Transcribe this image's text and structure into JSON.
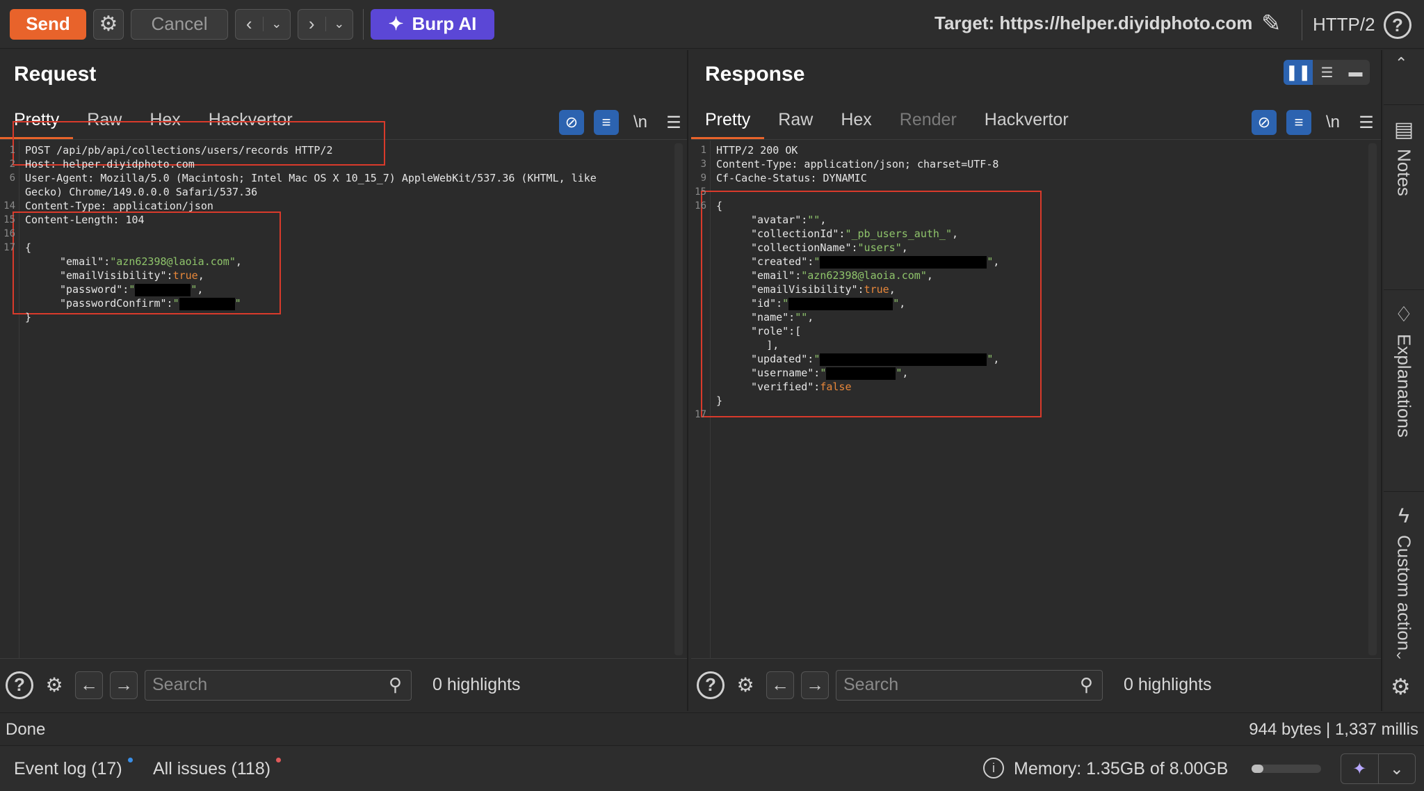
{
  "toolbar": {
    "send_label": "Send",
    "cancel_label": "Cancel",
    "burp_ai_label": "Burp AI",
    "target_label": "Target: https://helper.diyidphoto.com",
    "protocol_label": "HTTP/2"
  },
  "request": {
    "title": "Request",
    "tabs": [
      "Pretty",
      "Raw",
      "Hex",
      "Hackvertor"
    ],
    "active_tab": "Pretty",
    "wrap_label": "\\n",
    "lines": [
      {
        "n": "1",
        "text": "POST /api/pb/api/collections/users/records HTTP/2"
      },
      {
        "n": "2",
        "text": "Host: helper.diyidphoto.com"
      },
      {
        "n": "6",
        "text": "User-Agent: Mozilla/5.0 (Macintosh; Intel Mac OS X 10_15_7) AppleWebKit/537.36 (KHTML, like"
      },
      {
        "n": "",
        "text": "Gecko) Chrome/149.0.0.0 Safari/537.36"
      },
      {
        "n": "14",
        "text": "Content-Type: application/json"
      },
      {
        "n": "15",
        "text": "Content-Length: 104"
      },
      {
        "n": "16",
        "text": ""
      },
      {
        "n": "17",
        "text": "{"
      },
      {
        "n": "",
        "key": "\"email\":",
        "str": "\"azn62398@laoia.com\"",
        "tail": ","
      },
      {
        "n": "",
        "key": "\"emailVisibility\":",
        "bool": "true",
        "tail": ","
      },
      {
        "n": "",
        "key": "\"password\":",
        "str": "\"",
        "redact": "w80",
        "str2": "\"",
        "tail": ","
      },
      {
        "n": "",
        "key": "\"passwordConfirm\":",
        "str": "\"",
        "redact": "w80",
        "str2": "\""
      },
      {
        "n": "",
        "text": "}"
      }
    ]
  },
  "response": {
    "title": "Response",
    "tabs": [
      "Pretty",
      "Raw",
      "Hex",
      "Render",
      "Hackvertor"
    ],
    "active_tab": "Pretty",
    "wrap_label": "\\n",
    "lines": [
      {
        "n": "1",
        "text": "HTTP/2 200 OK"
      },
      {
        "n": "3",
        "text": "Content-Type: application/json; charset=UTF-8"
      },
      {
        "n": "9",
        "text": "Cf-Cache-Status: DYNAMIC"
      },
      {
        "n": "15",
        "text": ""
      },
      {
        "n": "16",
        "text": "{"
      },
      {
        "n": "",
        "key": "\"avatar\":",
        "str": "\"\"",
        "tail": ","
      },
      {
        "n": "",
        "key": "\"collectionId\":",
        "str": "\"_pb_users_auth_\"",
        "tail": ","
      },
      {
        "n": "",
        "key": "\"collectionName\":",
        "str": "\"users\"",
        "tail": ","
      },
      {
        "n": "",
        "key": "\"created\":",
        "str": "\"",
        "redact": "w240",
        "str2": "\"",
        "tail": ","
      },
      {
        "n": "",
        "key": "\"email\":",
        "str": "\"azn62398@laoia.com\"",
        "tail": ","
      },
      {
        "n": "",
        "key": "\"emailVisibility\":",
        "bool": "true",
        "tail": ","
      },
      {
        "n": "",
        "key": "\"id\":",
        "str": "\"",
        "redact": "w150",
        "str2": "\"",
        "tail": ","
      },
      {
        "n": "",
        "key": "\"name\":",
        "str": "\"\"",
        "tail": ","
      },
      {
        "n": "",
        "key": "\"role\":",
        "text2": "["
      },
      {
        "n": "",
        "text": "        ],"
      },
      {
        "n": "",
        "key": "\"updated\":",
        "str": "\"",
        "redact": "w240",
        "str2": "\"",
        "tail": ","
      },
      {
        "n": "",
        "key": "\"username\":",
        "str": "\"",
        "redact": "w100",
        "str2": "\"",
        "tail": ","
      },
      {
        "n": "",
        "key": "\"verified\":",
        "bool": "false"
      },
      {
        "n": "",
        "text": "}"
      },
      {
        "n": "17",
        "text": ""
      }
    ]
  },
  "search": {
    "placeholder": "Search",
    "left_highlights": "0 highlights",
    "right_highlights": "0 highlights"
  },
  "sidebar": {
    "items": [
      "Notes",
      "Explanations",
      "Custom action"
    ]
  },
  "status": {
    "left": "Done",
    "right": "944 bytes | 1,337 millis"
  },
  "footer": {
    "event_log": "Event log (17)",
    "all_issues": "All issues (118)",
    "memory": "Memory: 1.35GB of 8.00GB",
    "memory_fraction": 0.17,
    "event_dot_color": "#3a8ee6",
    "issues_dot_color": "#e05a5a"
  }
}
